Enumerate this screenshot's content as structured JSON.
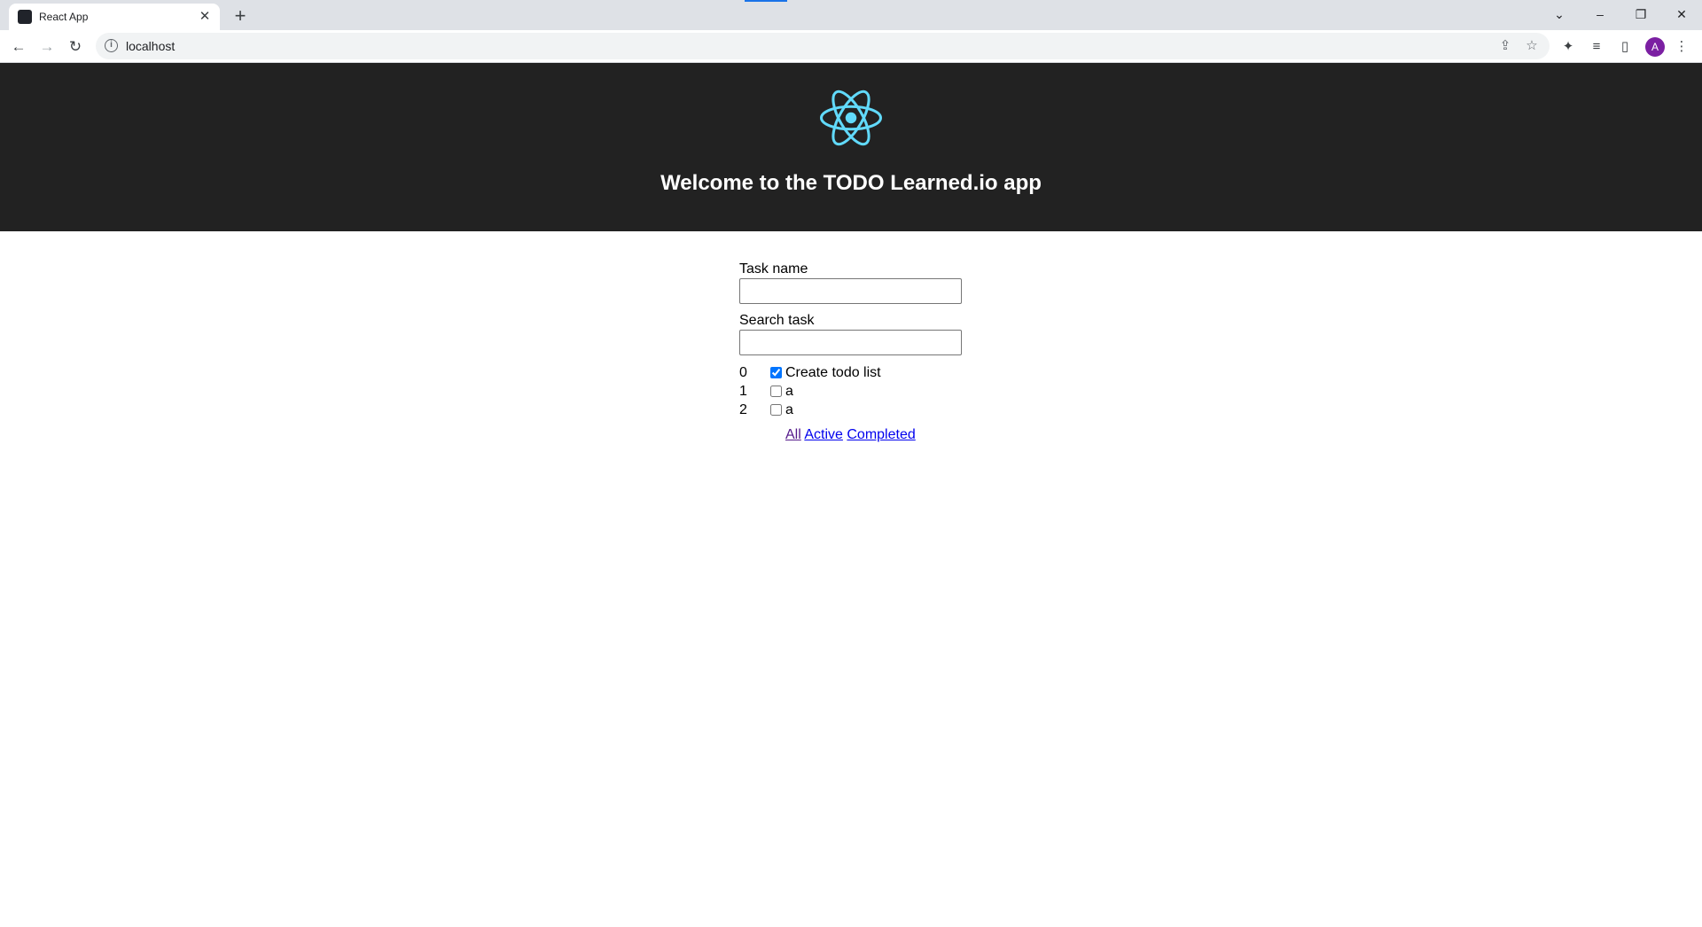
{
  "browser": {
    "tab_title": "React App",
    "url": "localhost",
    "avatar_letter": "A"
  },
  "header": {
    "title": "Welcome to the TODO Learned.io app"
  },
  "form": {
    "task_name_label": "Task name",
    "task_name_value": "",
    "search_label": "Search task",
    "search_value": ""
  },
  "tasks": [
    {
      "index": "0",
      "name": "Create todo list",
      "completed": true
    },
    {
      "index": "1",
      "name": "a",
      "completed": false
    },
    {
      "index": "2",
      "name": "a",
      "completed": false
    }
  ],
  "filters": {
    "all": "All",
    "active": "Active",
    "completed": "Completed"
  },
  "colors": {
    "header_bg": "#222222",
    "react_logo": "#61dafb",
    "link": "#0000ee",
    "link_visited": "#551a8b",
    "avatar": "#7b1fa2"
  }
}
